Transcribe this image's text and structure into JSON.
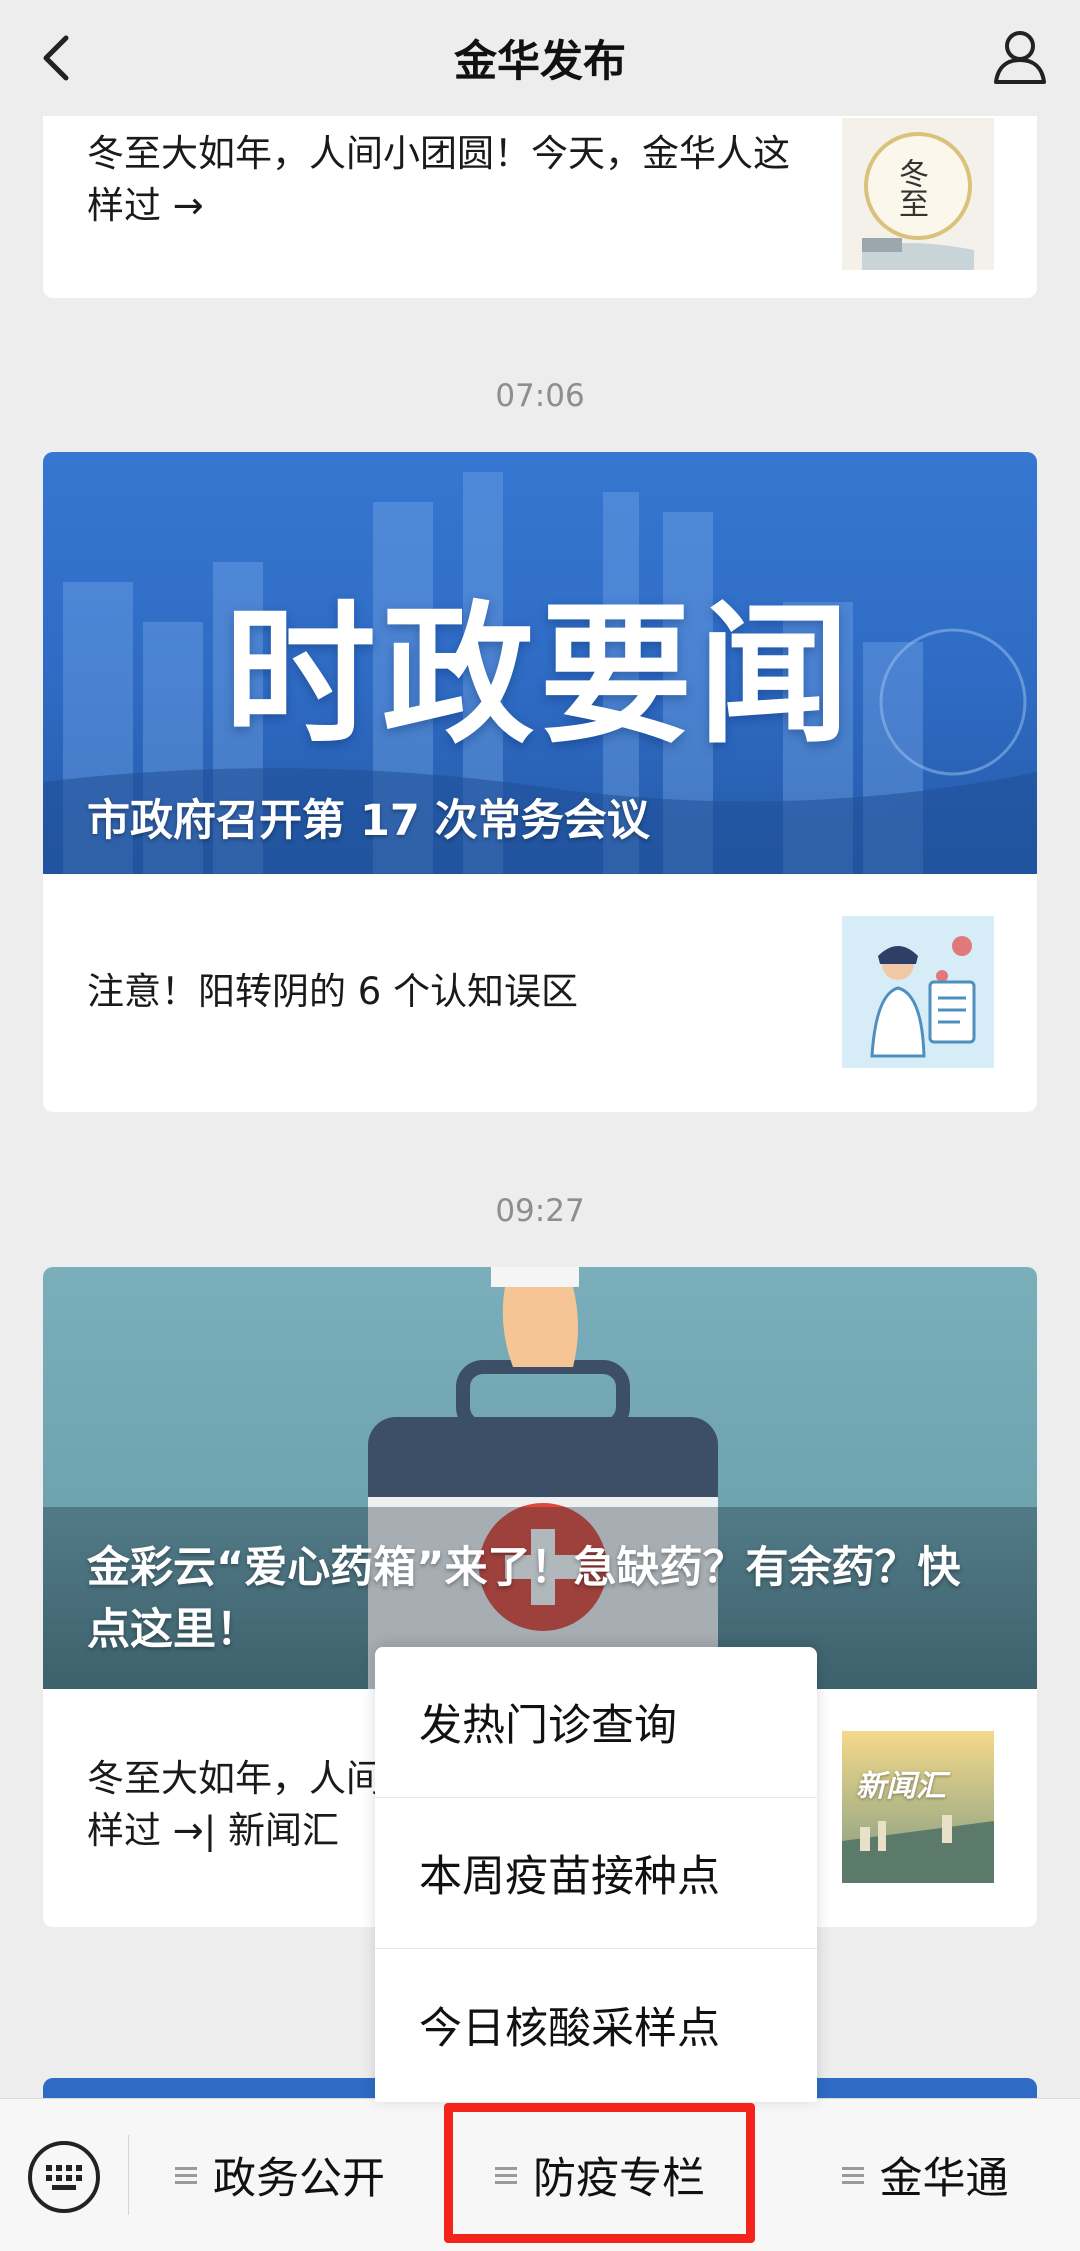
{
  "header": {
    "title": "金华发布"
  },
  "feed": {
    "top_card": {
      "title": "冬至大如年，人间小团圆！今天，金华人这样过 →",
      "thumb_text": "冬至"
    },
    "time1": "07:06",
    "card2": {
      "banner_headline": "时政要闻",
      "banner_caption": "市政府召开第 17 次常务会议",
      "item_title": "注意！阳转阴的 6 个认知误区"
    },
    "time2": "09:27",
    "card3": {
      "banner_caption": "金彩云“爱心药箱”来了！急缺药？有余药？快点这里！",
      "item_title": "冬至大如年，人间小团圆！今天，金华人这样过 →| 新闻汇",
      "thumb_text": "新闻汇"
    }
  },
  "popup_menu": {
    "items": [
      "发热门诊查询",
      "本周疫苗接种点",
      "今日核酸采样点"
    ]
  },
  "bottom_menu": {
    "tabs": [
      "政务公开",
      "防疫专栏",
      "金华通"
    ]
  },
  "colors": {
    "background": "#ededed",
    "highlight": "#f2241c",
    "banner_blue": "#2f6bc4",
    "banner_teal": "#6fa3b0"
  }
}
